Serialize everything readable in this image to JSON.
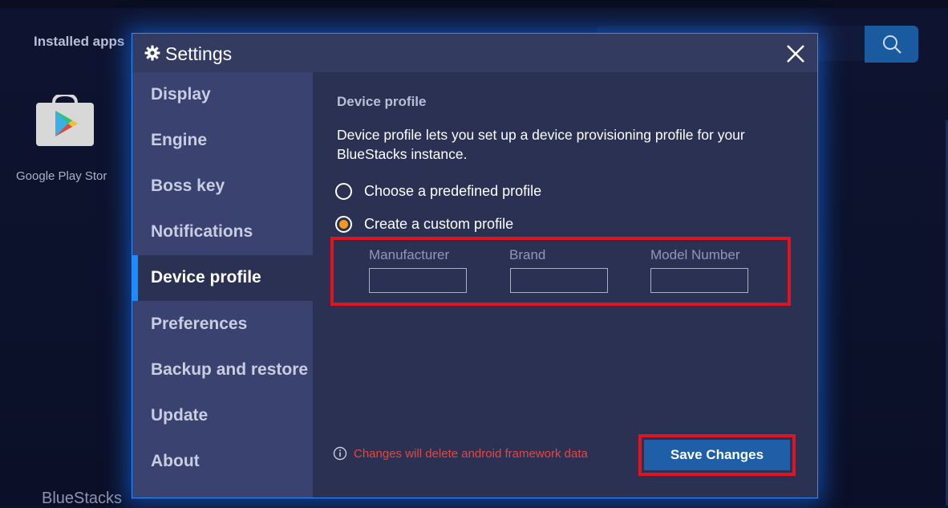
{
  "background": {
    "installed_apps_label": "Installed apps",
    "apps": [
      {
        "label": "Google Play Stor",
        "icon": "play-store-icon"
      }
    ],
    "brand_label": "BlueStacks",
    "search_icon": "search-icon"
  },
  "modal": {
    "title": "Settings",
    "title_icon": "gear-icon",
    "close_icon": "close-icon",
    "accent_color": "#1a8cff",
    "sidebar": [
      {
        "label": "Display"
      },
      {
        "label": "Engine"
      },
      {
        "label": "Boss key"
      },
      {
        "label": "Notifications"
      },
      {
        "label": "Device profile",
        "active": true
      },
      {
        "label": "Preferences"
      },
      {
        "label": "Backup and restore"
      },
      {
        "label": "Update"
      },
      {
        "label": "About"
      }
    ],
    "content": {
      "section_title": "Device profile",
      "description": "Device profile lets you set up a device provisioning profile for your BlueStacks instance.",
      "options": [
        {
          "label": "Choose a predefined profile",
          "checked": false
        },
        {
          "label": "Create a custom profile",
          "checked": true
        }
      ],
      "fields": [
        {
          "label": "Manufacturer",
          "value": ""
        },
        {
          "label": "Brand",
          "value": ""
        },
        {
          "label": "Model Number",
          "value": ""
        }
      ],
      "warning": "Changes will delete android framework data",
      "warning_color": "#e8453c",
      "save_label": "Save Changes"
    }
  }
}
